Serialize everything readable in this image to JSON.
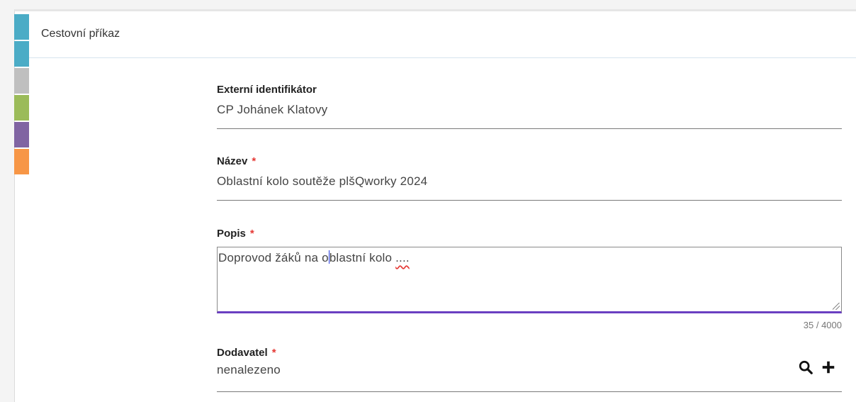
{
  "header": {
    "title": "Cestovní příkaz"
  },
  "color_strip": [
    "#4bacc6",
    "#4bacc6",
    "#bfbfbf",
    "#9bbb59",
    "#8064a2",
    "#f79646"
  ],
  "form": {
    "external_id": {
      "label": "Externí identifikátor",
      "value": "CP Johánek Klatovy"
    },
    "name": {
      "label": "Název",
      "required_mark": "*",
      "value": "Oblastní kolo soutěže plšQworky 2024"
    },
    "description": {
      "label": "Popis",
      "required_mark": "*",
      "value_before_caret": "Doprovod žáků na o",
      "value_after_caret": "blastní kolo ",
      "misspelled": "....",
      "counter": "35 / 4000"
    },
    "supplier": {
      "label": "Dodavatel",
      "required_mark": "*",
      "value": "nenalezeno",
      "icons": [
        "search-icon",
        "plus-icon"
      ]
    }
  }
}
